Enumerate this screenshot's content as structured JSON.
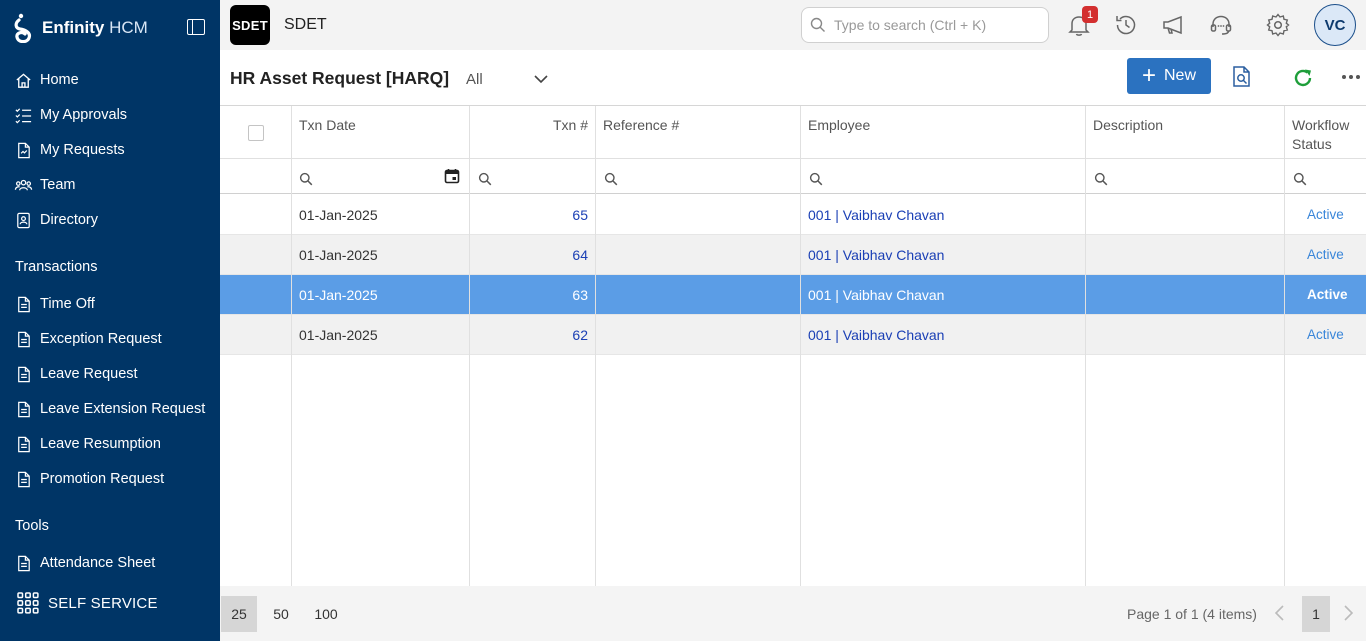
{
  "sidebar": {
    "brand_name": "Enfinity",
    "brand_suffix": "HCM",
    "main_items": [
      {
        "label": "Home",
        "icon": "home-icon"
      },
      {
        "label": "My Approvals",
        "icon": "checklist-icon"
      },
      {
        "label": "My Requests",
        "icon": "request-doc-icon"
      },
      {
        "label": "Team",
        "icon": "team-icon"
      },
      {
        "label": "Directory",
        "icon": "directory-icon"
      }
    ],
    "transactions_label": "Transactions",
    "transaction_items": [
      {
        "label": "Time Off",
        "icon": "document-icon"
      },
      {
        "label": "Exception Request",
        "icon": "document-icon"
      },
      {
        "label": "Leave Request",
        "icon": "document-icon"
      },
      {
        "label": "Leave Extension Request",
        "icon": "document-icon"
      },
      {
        "label": "Leave Resumption",
        "icon": "document-icon"
      },
      {
        "label": "Promotion Request",
        "icon": "document-icon"
      }
    ],
    "tools_label": "Tools",
    "tool_items": [
      {
        "label": "Attendance Sheet",
        "icon": "document-icon"
      }
    ],
    "self_service_label": "SELF SERVICE"
  },
  "topbar": {
    "org_badge": "SDET",
    "org_name": "SDET",
    "search_placeholder": "Type to search (Ctrl + K)",
    "notification_count": "1",
    "avatar_initials": "VC"
  },
  "page": {
    "title": "HR Asset Request [HARQ]",
    "filter_value": "All",
    "new_button_label": "New"
  },
  "grid": {
    "columns": [
      "Txn Date",
      "Txn #",
      "Reference #",
      "Employee",
      "Description",
      "Workflow Status"
    ],
    "rows": [
      {
        "date": "01-Jan-2025",
        "txn": "65",
        "reference": "",
        "employee": "001 | Vaibhav Chavan",
        "description": "",
        "status": "Active"
      },
      {
        "date": "01-Jan-2025",
        "txn": "64",
        "reference": "",
        "employee": "001 | Vaibhav Chavan",
        "description": "",
        "status": "Active"
      },
      {
        "date": "01-Jan-2025",
        "txn": "63",
        "reference": "",
        "employee": "001 | Vaibhav Chavan",
        "description": "",
        "status": "Active"
      },
      {
        "date": "01-Jan-2025",
        "txn": "62",
        "reference": "",
        "employee": "001 | Vaibhav Chavan",
        "description": "",
        "status": "Active"
      }
    ],
    "selected_row_index": 2
  },
  "pager": {
    "page_sizes": [
      "25",
      "50",
      "100"
    ],
    "active_page_size": "25",
    "info": "Page 1 of 1 (4 items)",
    "current_page": "1"
  }
}
